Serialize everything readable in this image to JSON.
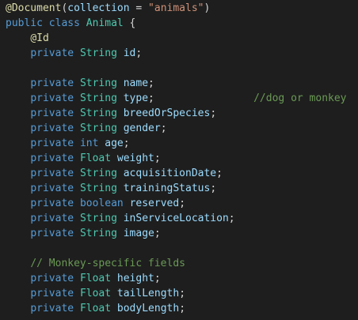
{
  "editor": {
    "colors": {
      "background": "#1e1e1e",
      "default": "#d4d4d4",
      "keyword": "#569cd6",
      "type": "#4ec9b0",
      "string": "#ce9178",
      "annotation": "#dcdcaa",
      "variable": "#9cdcfe",
      "comment": "#6a9955"
    },
    "lines": [
      [
        [
          "ann",
          "@Document"
        ],
        [
          "pun",
          "("
        ],
        [
          "var",
          "collection"
        ],
        [
          "pun",
          " = "
        ],
        [
          "str",
          "\"animals\""
        ],
        [
          "pun",
          ")"
        ]
      ],
      [
        [
          "kw",
          "public"
        ],
        [
          "pun",
          " "
        ],
        [
          "kw",
          "class"
        ],
        [
          "pun",
          " "
        ],
        [
          "type",
          "Animal"
        ],
        [
          "pun",
          " {"
        ]
      ],
      [
        [
          "pun",
          "    "
        ],
        [
          "ann",
          "@Id"
        ]
      ],
      [
        [
          "pun",
          "    "
        ],
        [
          "kw",
          "private"
        ],
        [
          "pun",
          " "
        ],
        [
          "type",
          "String"
        ],
        [
          "pun",
          " "
        ],
        [
          "var",
          "id"
        ],
        [
          "pun",
          ";"
        ]
      ],
      [],
      [
        [
          "pun",
          "    "
        ],
        [
          "kw",
          "private"
        ],
        [
          "pun",
          " "
        ],
        [
          "type",
          "String"
        ],
        [
          "pun",
          " "
        ],
        [
          "var",
          "name"
        ],
        [
          "pun",
          ";"
        ]
      ],
      [
        [
          "pun",
          "    "
        ],
        [
          "kw",
          "private"
        ],
        [
          "pun",
          " "
        ],
        [
          "type",
          "String"
        ],
        [
          "pun",
          " "
        ],
        [
          "var",
          "type"
        ],
        [
          "pun",
          ";                "
        ],
        [
          "cmt",
          "//dog or monkey"
        ]
      ],
      [
        [
          "pun",
          "    "
        ],
        [
          "kw",
          "private"
        ],
        [
          "pun",
          " "
        ],
        [
          "type",
          "String"
        ],
        [
          "pun",
          " "
        ],
        [
          "var",
          "breedOrSpecies"
        ],
        [
          "pun",
          ";"
        ]
      ],
      [
        [
          "pun",
          "    "
        ],
        [
          "kw",
          "private"
        ],
        [
          "pun",
          " "
        ],
        [
          "type",
          "String"
        ],
        [
          "pun",
          " "
        ],
        [
          "var",
          "gender"
        ],
        [
          "pun",
          ";"
        ]
      ],
      [
        [
          "pun",
          "    "
        ],
        [
          "kw",
          "private"
        ],
        [
          "pun",
          " "
        ],
        [
          "kw",
          "int"
        ],
        [
          "pun",
          " "
        ],
        [
          "var",
          "age"
        ],
        [
          "pun",
          ";"
        ]
      ],
      [
        [
          "pun",
          "    "
        ],
        [
          "kw",
          "private"
        ],
        [
          "pun",
          " "
        ],
        [
          "type",
          "Float"
        ],
        [
          "pun",
          " "
        ],
        [
          "var",
          "weight"
        ],
        [
          "pun",
          ";"
        ]
      ],
      [
        [
          "pun",
          "    "
        ],
        [
          "kw",
          "private"
        ],
        [
          "pun",
          " "
        ],
        [
          "type",
          "String"
        ],
        [
          "pun",
          " "
        ],
        [
          "var",
          "acquisitionDate"
        ],
        [
          "pun",
          ";"
        ]
      ],
      [
        [
          "pun",
          "    "
        ],
        [
          "kw",
          "private"
        ],
        [
          "pun",
          " "
        ],
        [
          "type",
          "String"
        ],
        [
          "pun",
          " "
        ],
        [
          "var",
          "trainingStatus"
        ],
        [
          "pun",
          ";"
        ]
      ],
      [
        [
          "pun",
          "    "
        ],
        [
          "kw",
          "private"
        ],
        [
          "pun",
          " "
        ],
        [
          "kw",
          "boolean"
        ],
        [
          "pun",
          " "
        ],
        [
          "var",
          "reserved"
        ],
        [
          "pun",
          ";"
        ]
      ],
      [
        [
          "pun",
          "    "
        ],
        [
          "kw",
          "private"
        ],
        [
          "pun",
          " "
        ],
        [
          "type",
          "String"
        ],
        [
          "pun",
          " "
        ],
        [
          "var",
          "inServiceLocation"
        ],
        [
          "pun",
          ";"
        ]
      ],
      [
        [
          "pun",
          "    "
        ],
        [
          "kw",
          "private"
        ],
        [
          "pun",
          " "
        ],
        [
          "type",
          "String"
        ],
        [
          "pun",
          " "
        ],
        [
          "var",
          "image"
        ],
        [
          "pun",
          ";"
        ]
      ],
      [],
      [
        [
          "pun",
          "    "
        ],
        [
          "cmt",
          "// Monkey-specific fields"
        ]
      ],
      [
        [
          "pun",
          "    "
        ],
        [
          "kw",
          "private"
        ],
        [
          "pun",
          " "
        ],
        [
          "type",
          "Float"
        ],
        [
          "pun",
          " "
        ],
        [
          "var",
          "height"
        ],
        [
          "pun",
          ";"
        ]
      ],
      [
        [
          "pun",
          "    "
        ],
        [
          "kw",
          "private"
        ],
        [
          "pun",
          " "
        ],
        [
          "type",
          "Float"
        ],
        [
          "pun",
          " "
        ],
        [
          "var",
          "tailLength"
        ],
        [
          "pun",
          ";"
        ]
      ],
      [
        [
          "pun",
          "    "
        ],
        [
          "kw",
          "private"
        ],
        [
          "pun",
          " "
        ],
        [
          "type",
          "Float"
        ],
        [
          "pun",
          " "
        ],
        [
          "var",
          "bodyLength"
        ],
        [
          "pun",
          ";"
        ]
      ]
    ]
  }
}
